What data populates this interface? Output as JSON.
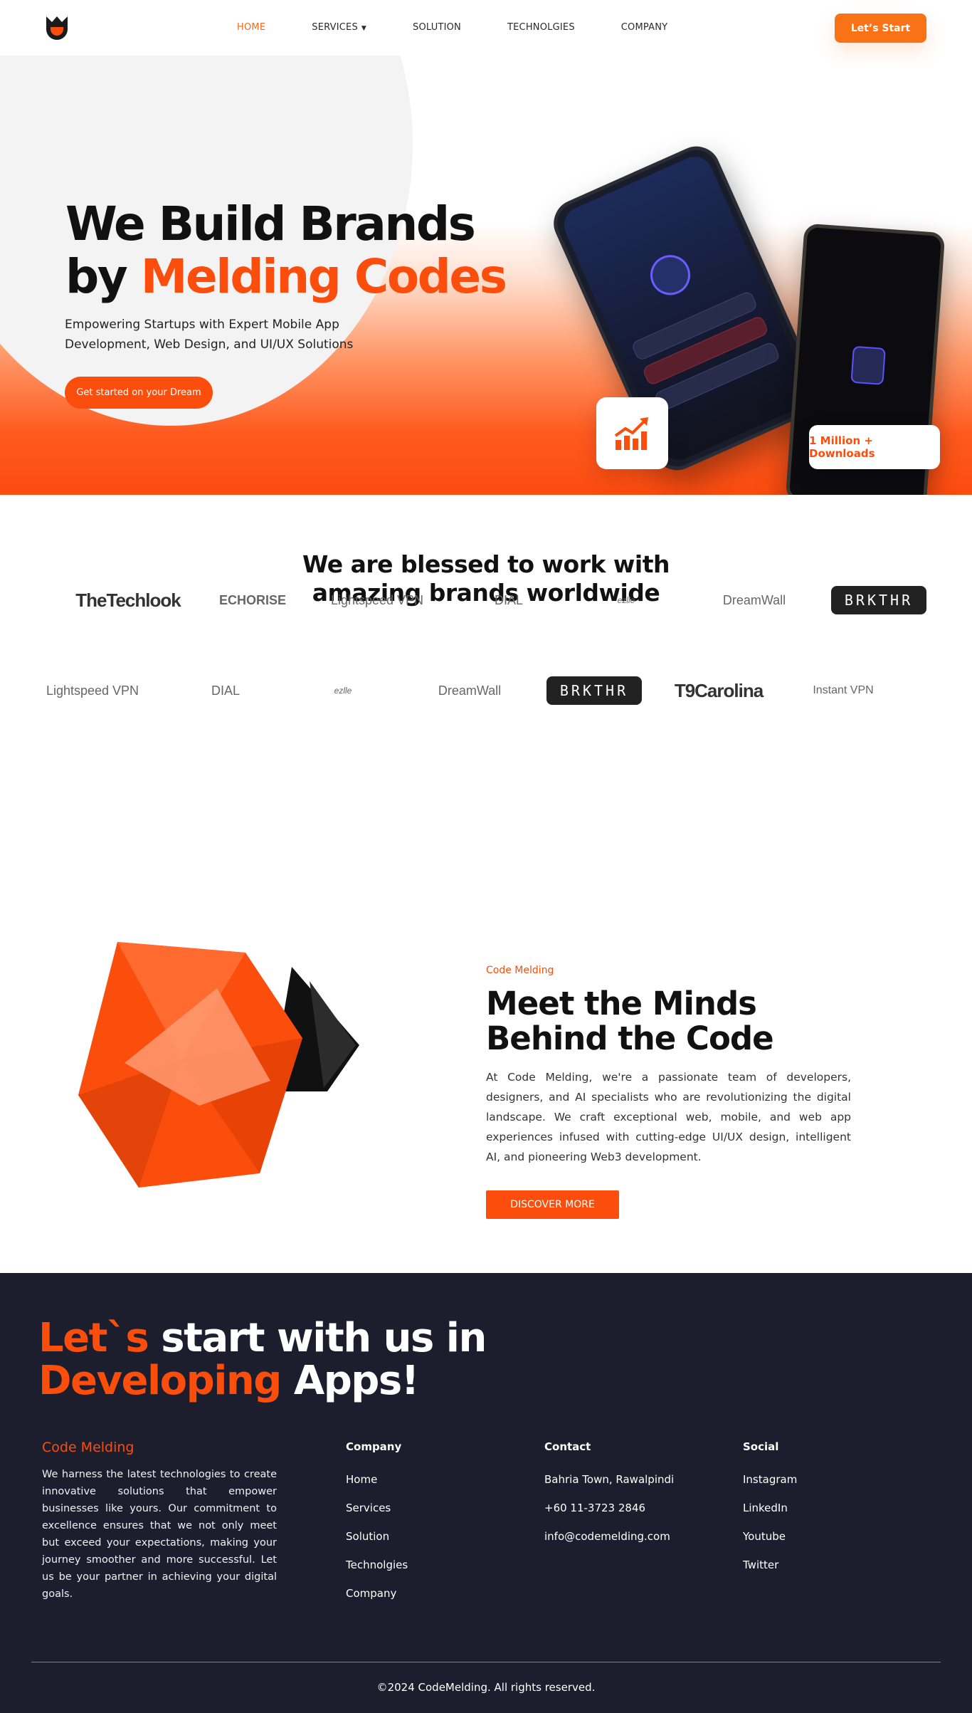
{
  "nav": {
    "links": [
      "HOME",
      "SERVICES",
      "SOLUTION",
      "TECHNOLGIES",
      "COMPANY"
    ],
    "start_label": "Let’s Start"
  },
  "hero": {
    "title_line1": "We Build Brands",
    "title_by": "by",
    "title_accent": "Melding Codes",
    "subtitle": "Empowering Startups with Expert Mobile App Development, Web Design, and UI/UX Solutions",
    "cta_label": "Get started on your Dream",
    "download_badge": "1 Million + Downloads"
  },
  "brands": {
    "title": "We are blessed to work with amazing brands worldwide",
    "row1": [
      "TheTechlook",
      "ECHORISE",
      "Lightspeed VPN",
      "DIAL",
      "ezlle",
      "DreamWall",
      "BRKTHR"
    ],
    "row2": [
      "Lightspeed VPN",
      "DIAL",
      "ezlle",
      "DreamWall",
      "BRKTHR",
      "T9Carolina",
      "Instant VPN"
    ]
  },
  "team": {
    "kicker": "Code Melding",
    "title": "Meet the Minds Behind the Code",
    "body": "At Code Melding, we're a passionate team of developers, designers, and AI specialists who are revolutionizing the digital landscape. We craft exceptional web, mobile, and web app experiences infused with cutting-edge UI/UX design, intelligent AI, and pioneering Web3 development.",
    "cta_label": "DISCOVER MORE"
  },
  "footer": {
    "headline_accent1": "Let`s",
    "headline_rest1": "start with us in",
    "headline_accent2": "Developing",
    "headline_rest2": "Apps!",
    "brand_name": "Code Melding",
    "about": "We harness the latest technologies to create innovative solutions that empower businesses like yours. Our commitment to excellence ensures that we not only meet but exceed your expectations, making your journey smoother and more successful. Let us be your partner in achieving your digital goals.",
    "company_title": "Company",
    "company_links": [
      "Home",
      "Services",
      "Solution",
      "Technolgies",
      "Company"
    ],
    "contact_title": "Contact",
    "contact_items": [
      "Bahria Town, Rawalpindi",
      "+60 11-3723 2846",
      "info@codemelding.com"
    ],
    "social_title": "Social",
    "social_links": [
      "Instagram",
      "LinkedIn",
      "Youtube",
      "Twitter"
    ],
    "copyright": "©2024 CodeMelding. All rights reserved."
  },
  "colors": {
    "accent": "#fb4e0c",
    "nav_button": "#f97316",
    "footer_bg": "#1c1e2d"
  }
}
